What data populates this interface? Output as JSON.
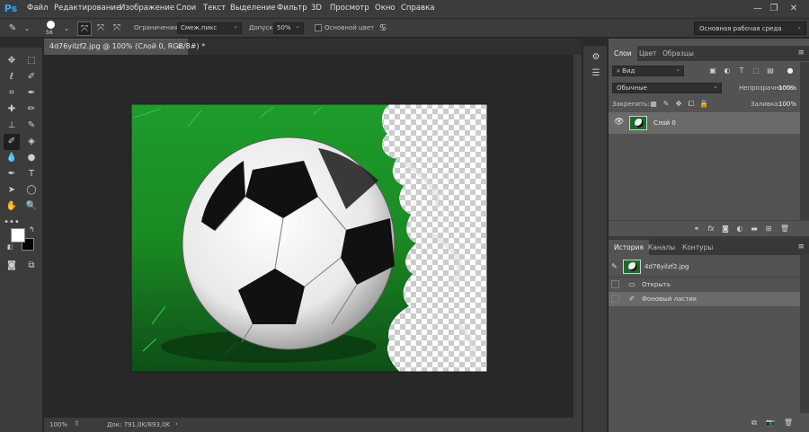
{
  "app": {
    "logo": "Ps"
  },
  "menu": [
    "Файл",
    "Редактирование",
    "Изображение",
    "Слои",
    "Текст",
    "Выделение",
    "Фильтр",
    "3D",
    "Просмотр",
    "Окно",
    "Справка"
  ],
  "window_controls": [
    "minimize-icon",
    "restore-icon",
    "close-icon"
  ],
  "options": {
    "brush_size": "56",
    "limits_label": "Ограничения:",
    "limits_value": "Смеж.пикс",
    "tolerance_label": "Допуск:",
    "tolerance_value": "50%",
    "protect_fg_label": "Основной цвет",
    "workspace": "Основная рабочая среда"
  },
  "document": {
    "tab_title": "4d76yilzf2.jpg @ 100% (Слой 0, RGB/8#) *",
    "close": "×",
    "zoom": "100%",
    "doc_info": "Док: 791,0K/893,0K"
  },
  "colors": {
    "foreground": "#ffffff",
    "background": "#000000",
    "accent": "#31a8ff"
  },
  "layers_panel": {
    "tabs": [
      "Слои",
      "Цвет",
      "Образцы"
    ],
    "filter_label": "Вид",
    "blend_mode": "Обычные",
    "opacity_label": "Непрозрачность:",
    "opacity_value": "100%",
    "lock_label": "Закрепить:",
    "fill_label": "Заливка:",
    "fill_value": "100%",
    "layers": [
      {
        "name": "Слой 0",
        "visible": true
      }
    ]
  },
  "history_panel": {
    "tabs": [
      "История",
      "Каналы",
      "Контуры"
    ],
    "snapshot": "4d76yilzf2.jpg",
    "states": [
      "Открыть",
      "Фоновый ластик"
    ]
  }
}
